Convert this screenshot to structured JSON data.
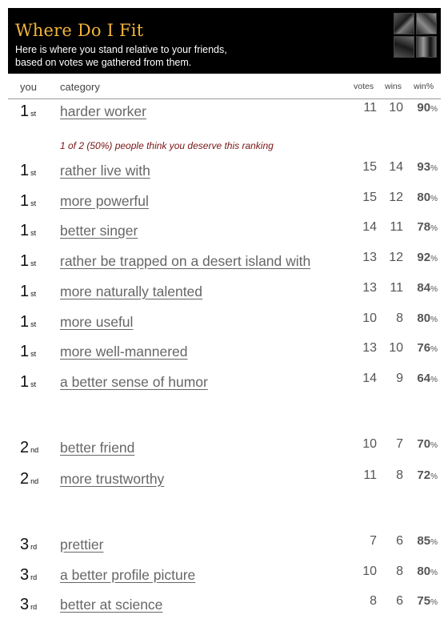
{
  "header": {
    "title": "Where Do I Fit",
    "subtitle_line1": "Here is where you stand relative to your friends,",
    "subtitle_line2": "based on votes we gathered from them."
  },
  "columns": {
    "you": "you",
    "category": "category",
    "votes": "votes",
    "wins": "wins",
    "winpct": "win%"
  },
  "note": "1 of 2 (50%) people think you deserve this ranking",
  "rows": [
    {
      "rank": "1",
      "suffix": "st",
      "category": "harder worker",
      "votes": "11",
      "wins": "10",
      "pct": "90"
    },
    {
      "rank": "1",
      "suffix": "st",
      "category": "rather live with",
      "votes": "15",
      "wins": "14",
      "pct": "93"
    },
    {
      "rank": "1",
      "suffix": "st",
      "category": "more powerful",
      "votes": "15",
      "wins": "12",
      "pct": "80"
    },
    {
      "rank": "1",
      "suffix": "st",
      "category": "better singer",
      "votes": "14",
      "wins": "11",
      "pct": "78"
    },
    {
      "rank": "1",
      "suffix": "st",
      "category": "rather be trapped on a desert island with",
      "votes": "13",
      "wins": "12",
      "pct": "92"
    },
    {
      "rank": "1",
      "suffix": "st",
      "category": "more naturally talented",
      "votes": "13",
      "wins": "11",
      "pct": "84"
    },
    {
      "rank": "1",
      "suffix": "st",
      "category": "more useful",
      "votes": "10",
      "wins": "8",
      "pct": "80"
    },
    {
      "rank": "1",
      "suffix": "st",
      "category": "more well-mannered",
      "votes": "13",
      "wins": "10",
      "pct": "76"
    },
    {
      "rank": "1",
      "suffix": "st",
      "category": "a better sense of humor",
      "votes": "14",
      "wins": "9",
      "pct": "64"
    },
    {
      "rank": "2",
      "suffix": "nd",
      "category": "better friend",
      "votes": "10",
      "wins": "7",
      "pct": "70"
    },
    {
      "rank": "2",
      "suffix": "nd",
      "category": "more trustworthy",
      "votes": "11",
      "wins": "8",
      "pct": "72"
    },
    {
      "rank": "3",
      "suffix": "rd",
      "category": "prettier",
      "votes": "7",
      "wins": "6",
      "pct": "85"
    },
    {
      "rank": "3",
      "suffix": "rd",
      "category": "a better profile picture",
      "votes": "10",
      "wins": "8",
      "pct": "80"
    },
    {
      "rank": "3",
      "suffix": "rd",
      "category": "better at science",
      "votes": "8",
      "wins": "6",
      "pct": "75"
    }
  ],
  "percent_sign": "%"
}
